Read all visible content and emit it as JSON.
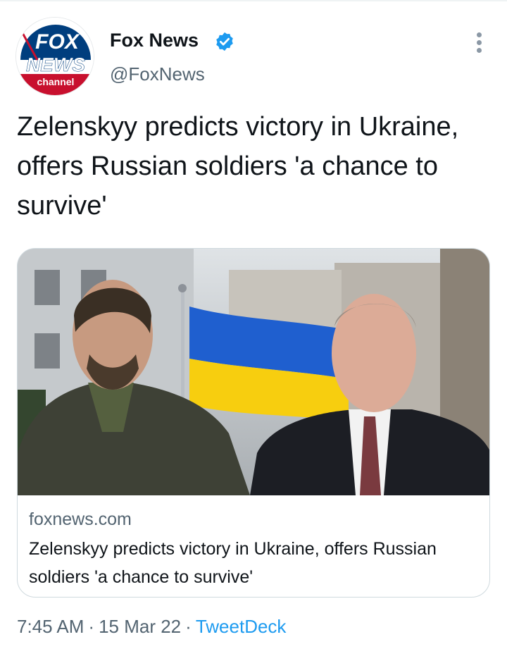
{
  "author": {
    "name": "Fox News",
    "handle": "@FoxNews",
    "verified": true,
    "avatar_logo_text": [
      "FOX",
      "NEWS",
      "channel"
    ]
  },
  "tweet": {
    "text": "Zelenskyy predicts victory in Ukraine, offers Russian soldiers 'a chance to survive'"
  },
  "card": {
    "domain": "foxnews.com",
    "title": "Zelenskyy predicts victory in Ukraine, offers Russian soldiers 'a chance to survive'"
  },
  "meta": {
    "time": "7:45 AM",
    "separator": "·",
    "date": "15 Mar 22",
    "source": "TweetDeck"
  },
  "icons": {
    "verified": "verified-badge-icon",
    "more": "more-options-icon"
  },
  "colors": {
    "link": "#1d9bf0",
    "secondary_text": "#536471",
    "verified": "#1d9bf0",
    "fox_red": "#c8102e",
    "fox_blue": "#003366",
    "flag_blue": "#1d5ec9",
    "flag_yellow": "#f6cf0e"
  }
}
